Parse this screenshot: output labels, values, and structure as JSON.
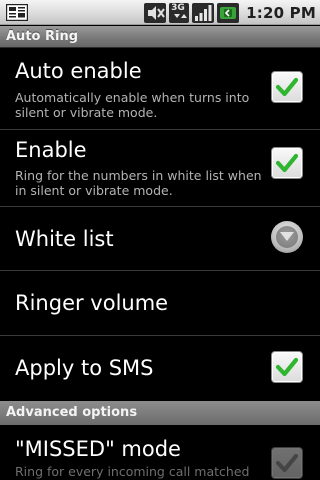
{
  "status_bar": {
    "time": "1:20 PM",
    "network_label": "3G"
  },
  "title_bar": {
    "title": "Auto Ring"
  },
  "preferences": [
    {
      "title": "Auto enable",
      "summary": "Automatically enable when turns into silent or vibrate mode.",
      "control": "checkbox",
      "checked": true
    },
    {
      "title": "Enable",
      "summary": "Ring for the numbers in white list when in silent or vibrate mode.",
      "control": "checkbox",
      "checked": true
    },
    {
      "title": "White list",
      "control": "chevron-down-button"
    },
    {
      "title": "Ringer volume",
      "control": "none"
    },
    {
      "title": "Apply to SMS",
      "control": "checkbox",
      "checked": true
    }
  ],
  "advanced_section": {
    "header": "Advanced options",
    "items": [
      {
        "title": "\"MISSED\" mode",
        "summary": "Ring for every incoming call matched",
        "control": "checkbox",
        "checked": true,
        "enabled": false
      }
    ]
  },
  "colors": {
    "checkmark": "#2fb52f",
    "background": "#000000",
    "summary_text": "#b4b4b4"
  }
}
